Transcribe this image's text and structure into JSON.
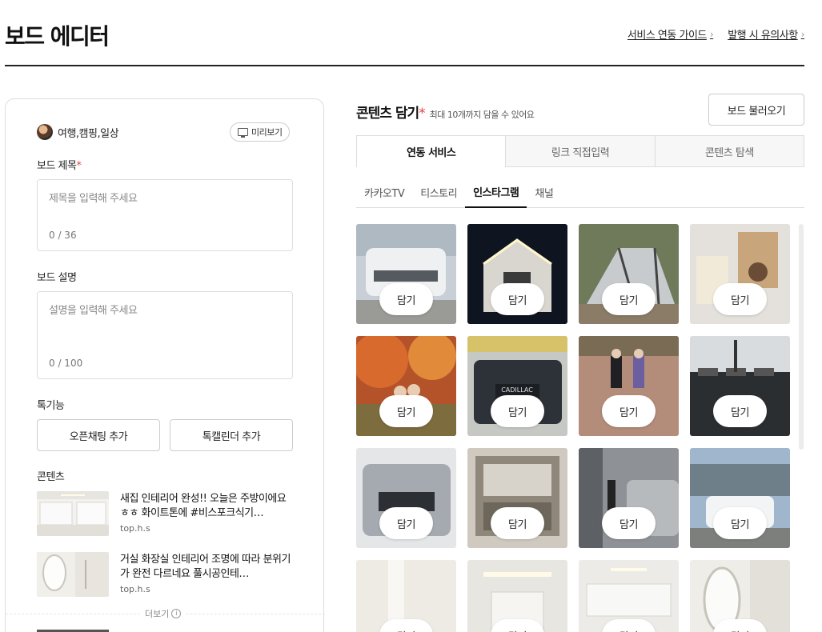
{
  "page": {
    "title": "보드 에디터"
  },
  "header_links": [
    {
      "label": "서비스 연동 가이드"
    },
    {
      "label": "발행 시 유의사항"
    }
  ],
  "editor": {
    "profile_name": "여행,캠핑,일상",
    "preview_label": "미리보기",
    "title_label": "보드 제목",
    "required_mark": "*",
    "title_placeholder": "제목을 입력해 주세요",
    "title_count": "0 / 36",
    "desc_label": "보드 설명",
    "desc_placeholder": "설명을 입력해 주세요",
    "desc_count": "0 / 100",
    "features_label": "톡기능",
    "open_chat_label": "오픈채팅 추가",
    "talk_calendar_label": "톡캘린더 추가",
    "contents_label": "콘텐츠",
    "contents": [
      {
        "title": "새집 인테리어 완성!! 오늘은 주방이에요 ㅎㅎ 화이트톤에 #비스포크식기…",
        "source": "top.h.s"
      },
      {
        "title": "거실 화장실 인테리어 조명에 따라 분위기가 완전 다르네요 풀시공인테…",
        "source": "top.h.s"
      }
    ],
    "more_label": "더보기"
  },
  "contents_panel": {
    "title": "콘텐츠 담기",
    "required_mark": "*",
    "subtitle": "최대 10개까지 담을 수 있어요",
    "load_board_label": "보드 불러오기",
    "tabs": [
      "연동 서비스",
      "링크 직접입력",
      "콘텐츠 탐색"
    ],
    "active_tab": "연동 서비스",
    "service_tabs": [
      "카카오TV",
      "티스토리",
      "인스타그램",
      "채널"
    ],
    "active_service": "인스타그램",
    "pick_label": "담기",
    "thumbnails": [
      {
        "subject": "white-suv"
      },
      {
        "subject": "lit-tent-night"
      },
      {
        "subject": "grey-tent"
      },
      {
        "subject": "food-packages"
      },
      {
        "subject": "autumn-couple"
      },
      {
        "subject": "cadillac-front"
      },
      {
        "subject": "field-couple"
      },
      {
        "subject": "trash-bins"
      },
      {
        "subject": "silver-cadillac"
      },
      {
        "subject": "interior-cabinet"
      },
      {
        "subject": "car-wash"
      },
      {
        "subject": "white-suv-building"
      },
      {
        "subject": "bathroom-white"
      },
      {
        "subject": "living-room"
      },
      {
        "subject": "kitchen"
      },
      {
        "subject": "bathroom-mirror"
      }
    ]
  },
  "colors": {
    "required": "#e8413c",
    "accent_text": "#111111",
    "border": "#dddddd"
  }
}
